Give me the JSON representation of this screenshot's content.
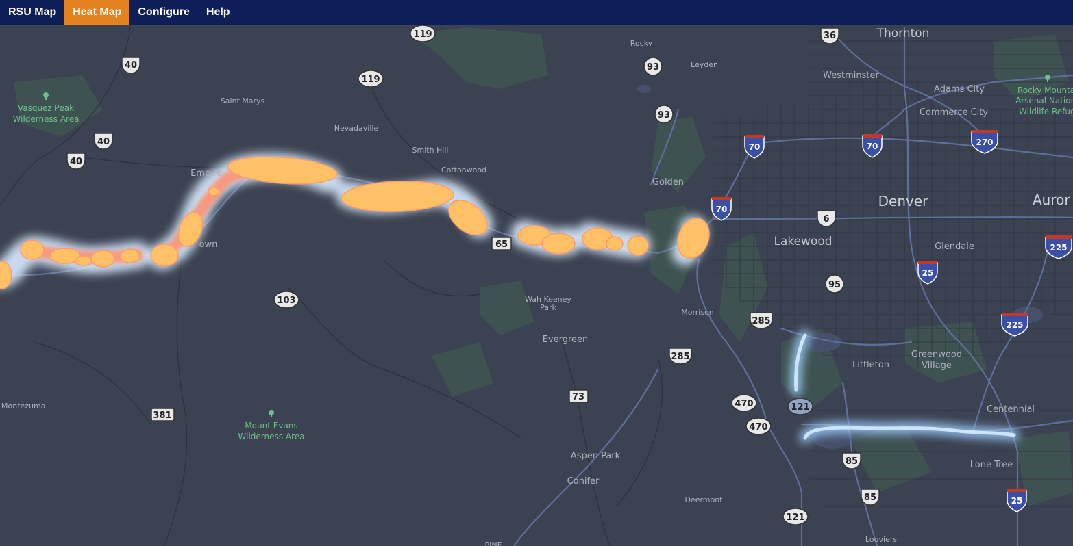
{
  "nav": {
    "tabs": [
      {
        "label": "RSU Map",
        "active": false
      },
      {
        "label": "Heat Map",
        "active": true
      },
      {
        "label": "Configure",
        "active": false
      },
      {
        "label": "Help",
        "active": false
      }
    ],
    "active_color": "#e4821f",
    "bar_color": "#0e1f57"
  },
  "map": {
    "background_color": "#3a4150",
    "heat_colors": {
      "warm_core": "#ffc066",
      "warm_glow": "#cfe3ff",
      "cool": "#9fd0ff"
    },
    "places": {
      "thornton": "Thornton",
      "westminster": "Westminster",
      "adams_city": "Adams City",
      "commerce_city": "Commerce City",
      "rocky": "Rocky",
      "leyden": "Leyden",
      "golden": "Golden",
      "denver": "Denver",
      "aurora": "Auror",
      "lakewood": "Lakewood",
      "glendale": "Glendale",
      "morrison": "Morrison",
      "littleton": "Littleton",
      "greenwood_village_1": "Greenwood",
      "greenwood_village_2": "Village",
      "centennial": "Centennial",
      "lone_tree": "Lone Tree",
      "evergreen": "Evergreen",
      "wah_keeney_1": "Wah Keeney",
      "wah_keeney_2": "Park",
      "aspen_park": "Aspen Park",
      "conifer": "Conifer",
      "deermont": "Deermont",
      "louviers": "Louviers",
      "pine": "PINE",
      "saint_marys": "Saint Marys",
      "nevadaville": "Nevadaville",
      "smith_hill": "Smith Hill",
      "cottonwood": "Cottonwood",
      "empire": "Empire",
      "georgetown_fragment": "own",
      "montezuma": "Montezuma"
    },
    "parks": {
      "vasquez_1": "Vasquez Peak",
      "vasquez_2": "Wilderness Area",
      "mount_evans_1": "Mount Evans",
      "mount_evans_2": "Wilderness Area",
      "rocky_mountain_1": "Rocky Mounta",
      "rocky_mountain_2": "Arsenal Nation",
      "rocky_mountain_3": "Wildlife Refug"
    },
    "shields": {
      "us36": "36",
      "co119a": "119",
      "co119b": "119",
      "us40a": "40",
      "us40b": "40",
      "us40c": "40",
      "co93a": "93",
      "co93b": "93",
      "i70a": "70",
      "i70b": "70",
      "i70c": "70",
      "i270": "270",
      "us6": "6",
      "co65": "65",
      "i25a": "25",
      "i25b": "25",
      "i225a": "225",
      "i225b": "225",
      "co95": "95",
      "us285a": "285",
      "us285b": "285",
      "co103": "103",
      "co121a": "121",
      "co121b": "121",
      "co470a": "470",
      "co470b": "470",
      "co73": "73",
      "co381": "381",
      "us85a": "85",
      "us85b": "85"
    }
  }
}
